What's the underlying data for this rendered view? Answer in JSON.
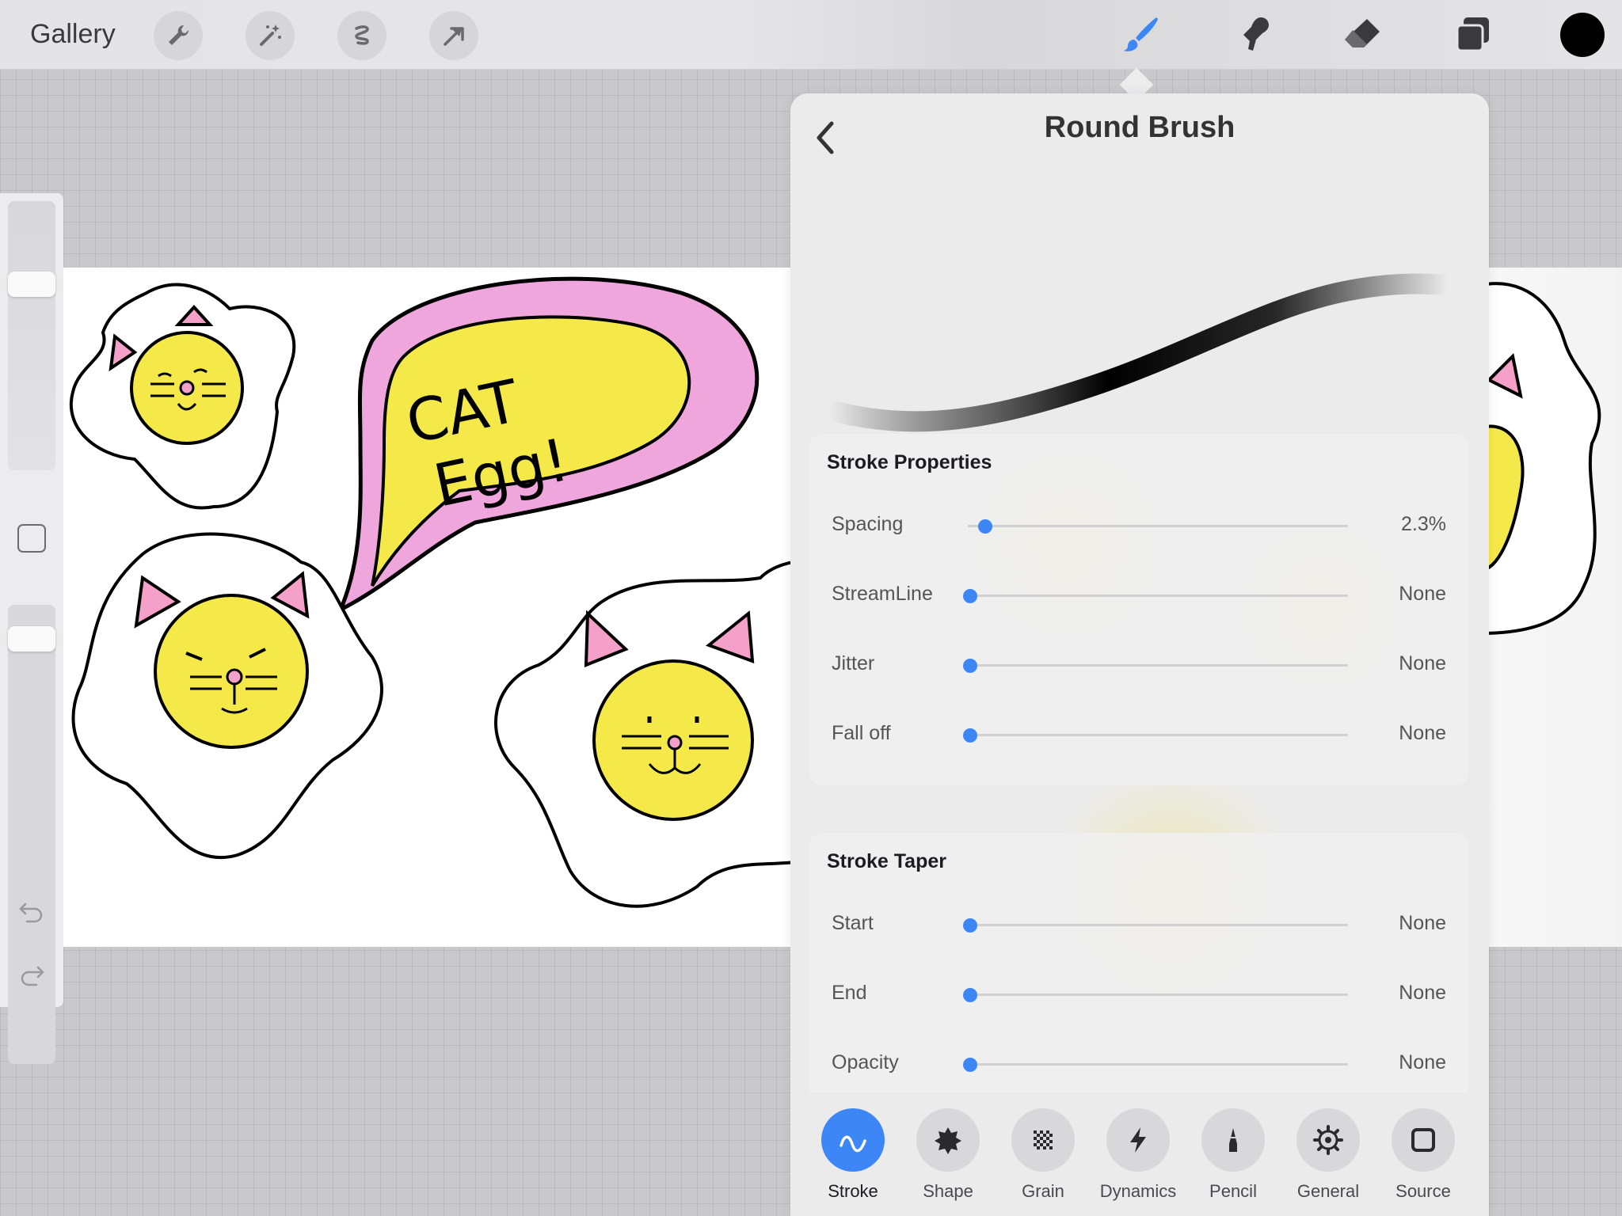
{
  "topbar": {
    "gallery_label": "Gallery",
    "left_tools": [
      "wrench-icon",
      "magic-wand-icon",
      "selection-icon",
      "transform-arrow-icon"
    ],
    "right_tools": [
      "brush-icon",
      "smudge-icon",
      "eraser-icon",
      "layers-icon"
    ],
    "active_tool": "brush",
    "current_color": "#000000"
  },
  "sidebar": {
    "brush_size_level": 0.71,
    "opacity_level": 0.95,
    "undo_icon": "undo-icon",
    "redo_icon": "redo-icon"
  },
  "canvas": {
    "speech_bubble_text_line1": "CAT",
    "speech_bubble_text_line2": "Egg!",
    "colors": {
      "yolk": "#f5e94a",
      "bubble": "#eea6dd",
      "ear_inner": "#f4a0c8",
      "outline": "#000000"
    }
  },
  "brush_panel": {
    "title": "Round Brush",
    "back_icon": "chevron-left-icon",
    "stroke_properties": {
      "heading": "Stroke Properties",
      "rows": [
        {
          "label": "Spacing",
          "value": "2.3%",
          "level": 0.02
        },
        {
          "label": "StreamLine",
          "value": "None",
          "level": 0
        },
        {
          "label": "Jitter",
          "value": "None",
          "level": 0
        },
        {
          "label": "Fall off",
          "value": "None",
          "level": 0
        }
      ]
    },
    "stroke_taper": {
      "heading": "Stroke Taper",
      "rows": [
        {
          "label": "Start",
          "value": "None",
          "level": 0
        },
        {
          "label": "End",
          "value": "None",
          "level": 0
        },
        {
          "label": "Opacity",
          "value": "None",
          "level": 0
        }
      ]
    },
    "tabs": [
      {
        "label": "Stroke",
        "icon": "stroke-wave-icon",
        "active": true
      },
      {
        "label": "Shape",
        "icon": "shape-blob-icon",
        "active": false
      },
      {
        "label": "Grain",
        "icon": "grain-checker-icon",
        "active": false
      },
      {
        "label": "Dynamics",
        "icon": "lightning-icon",
        "active": false
      },
      {
        "label": "Pencil",
        "icon": "pencil-icon",
        "active": false
      },
      {
        "label": "General",
        "icon": "gear-icon",
        "active": false
      },
      {
        "label": "Source",
        "icon": "square-source-icon",
        "active": false
      }
    ],
    "accent_color": "#3d86f5"
  }
}
